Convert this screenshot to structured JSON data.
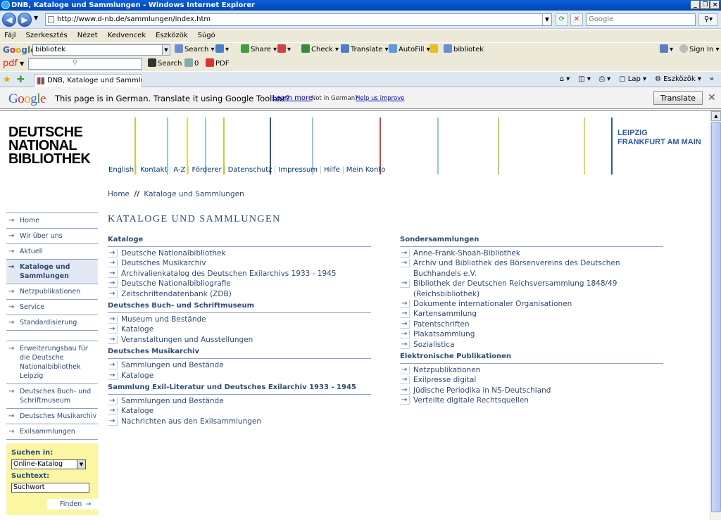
{
  "window": {
    "title": "DNB, Kataloge und Sammlungen - Windows Internet Explorer",
    "controls": [
      "_",
      "❐",
      "×"
    ]
  },
  "addressbar": {
    "url": "http://www.d-nb.de/sammlungen/index.htm",
    "search_placeholder": "Google"
  },
  "menubar": [
    "Fájl",
    "Szerkesztés",
    "Nézet",
    "Kedvencek",
    "Eszközök",
    "Súgó"
  ],
  "google_toolbar": {
    "logo": "Google",
    "query": "bibliotek",
    "search_label": "Search",
    "share_label": "Share",
    "check_label": "Check",
    "translate_label": "Translate",
    "autofill_label": "AutoFill",
    "bibliotek_label": "bibliotek",
    "signin_label": "Sign In"
  },
  "pdf_toolbar": {
    "logo": "pdf",
    "search_label": "Search",
    "count": "0",
    "pdf_label": "PDF"
  },
  "tabbar": {
    "tab_title": "DNB, Kataloge und Sammlungen",
    "page_label": "Lap",
    "tools_label": "Eszközök"
  },
  "translate_bar": {
    "logo": "Google",
    "message": "This page is in German.  Translate it using Google Toolbar?",
    "learn_more": "Learn more",
    "not_german": "Not in German?",
    "help_improve": "Help us improve",
    "translate_button": "Translate"
  },
  "site": {
    "logo_lines": [
      "DEUTSCHE",
      "NATIONAL",
      "BIBLIOTHEK"
    ],
    "stripe_colors": [
      "#c9cc3a",
      "#8fc8e8",
      "#e6d94a",
      "#8fc8e8",
      "#c9cc3a",
      "#2a5ba8",
      "#8fc8e8",
      "#d9404a",
      "#8fc8e8",
      "#c9cc3a",
      "#e6d94a"
    ],
    "top_nav": [
      "English",
      "Kontakt",
      "A-Z",
      "Förderer",
      "Datenschutz",
      "Impressum",
      "Hilfe",
      "Mein Konto"
    ],
    "cities": [
      "LEIPZIG",
      "FRANKFURT AM MAIN"
    ],
    "breadcrumb": {
      "home": "Home",
      "separator": "//",
      "current": "Kataloge und Sammlungen"
    },
    "page_title": "KATALOGE UND SAMMLUNGEN",
    "arrow": "→"
  },
  "sidebar": {
    "main": [
      {
        "label": "Home"
      },
      {
        "label": "Wir über uns"
      },
      {
        "label": "Aktuell"
      },
      {
        "label": "Kataloge und Sammlungen"
      },
      {
        "label": "Netzpublikationen"
      },
      {
        "label": "Service"
      },
      {
        "label": "Standardisierung"
      }
    ],
    "secondary": [
      {
        "label": "Erweiterungsbau für die Deutsche Nationalbibliothek Leipzig"
      },
      {
        "label": "Deutsches Buch- und Schriftmuseum"
      },
      {
        "label": "Deutsches Musikarchiv"
      },
      {
        "label": "Exilsammlungen"
      }
    ]
  },
  "search": {
    "in_label": "Suchen in:",
    "selected": "Online-Katalog",
    "text_label": "Suchtext:",
    "text_value": "Suchwort",
    "button": "Finden"
  },
  "content": {
    "left": [
      {
        "title": "Kataloge",
        "links": [
          "Deutsche Nationalbibliothek",
          "Deutsches Musikarchiv",
          "Archivalienkatalog des Deutschen Exilarchivs 1933 - 1945",
          "Deutsche Nationalbibliografie",
          "Zeitschriftendatenbank (ZDB)"
        ]
      },
      {
        "title": "Deutsches Buch- und Schriftmuseum",
        "links": [
          "Museum und Bestände",
          "Kataloge",
          "Veranstaltungen und Ausstellungen"
        ]
      },
      {
        "title": "Deutsches Musikarchiv",
        "links": [
          "Sammlungen und Bestände",
          "Kataloge"
        ]
      },
      {
        "title": "Sammlung Exil-Literatur und Deutsches Exilarchiv 1933 - 1945",
        "links": [
          "Sammlungen und Bestände",
          "Kataloge",
          "Nachrichten aus den Exilsammlungen"
        ]
      }
    ],
    "right": [
      {
        "title": "Sondersammlungen",
        "links": [
          "Anne-Frank-Shoah-Bibliothek",
          "Archiv und Bibliothek des Börsenvereins des Deutschen Buchhandels e.V.",
          "Bibliothek der Deutschen Reichsversammlung 1848/49 (Reichsbibliothek)",
          "Dokumente internationaler Organisationen",
          "Kartensammlung",
          "Patentschriften",
          "Plakatsammlung",
          "Sozialistica"
        ]
      },
      {
        "title": "Elektronische Publikationen",
        "links": [
          "Netzpublikationen",
          "Exilpresse digital",
          "Jüdische Periodika in NS-Deutschland",
          "Verteilte digitale Rechtsquellen"
        ]
      }
    ]
  }
}
